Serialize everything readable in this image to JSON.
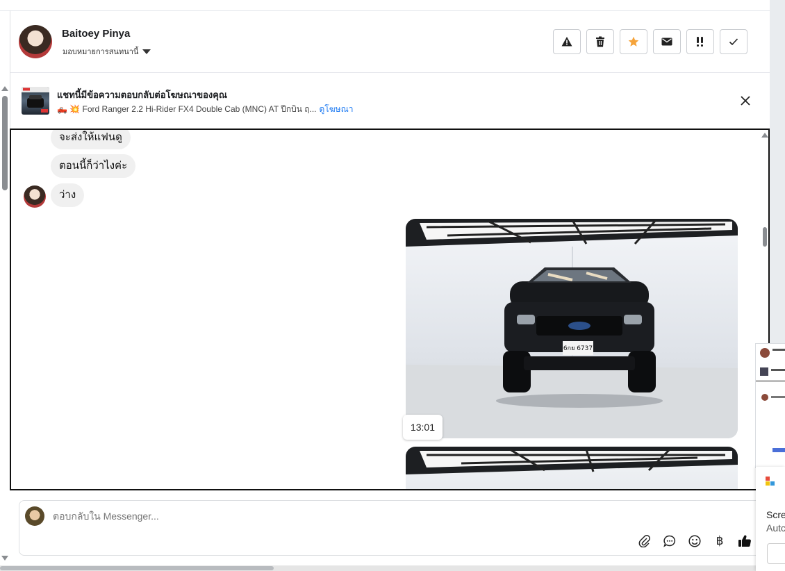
{
  "header": {
    "name": "Baitoey Pinya",
    "subtitle": "มอบหมายการสนทนานี้"
  },
  "actions": [
    {
      "name": "report-spam-button",
      "icon": "warning-icon"
    },
    {
      "name": "delete-button",
      "icon": "trash-icon"
    },
    {
      "name": "star-button",
      "icon": "star-icon"
    },
    {
      "name": "mark-unread-button",
      "icon": "envelope-icon"
    },
    {
      "name": "follow-up-button",
      "icon": "double-exclamation-icon"
    },
    {
      "name": "mark-done-button",
      "icon": "check-icon"
    }
  ],
  "ad": {
    "title": "แชทนี้มีข้อความตอบกลับต่อโฆษณาของคุณ",
    "description": "🛻 💥 Ford Ranger 2.2 Hi-Rider FX4 Double Cab (MNC) AT ปีกบิน ฤ...",
    "link": "ดูโฆษณา"
  },
  "messages": [
    {
      "text": "จะส่งให้แฟนดู"
    },
    {
      "text": "ตอนนี้ก็ว่าไงค่ะ"
    },
    {
      "text": "ว่าง"
    }
  ],
  "photo": {
    "plate": "6กย 6737",
    "timestamp": "13:01"
  },
  "composer": {
    "placeholder": "ตอบกลับใน Messenger...",
    "currency_symbol": "฿"
  },
  "side_dialog": {
    "title": "Scre",
    "subtitle": "Autc"
  },
  "colors": {
    "star": "#f5a33a",
    "link": "#1877f2",
    "bubble": "#f0f0f0"
  }
}
